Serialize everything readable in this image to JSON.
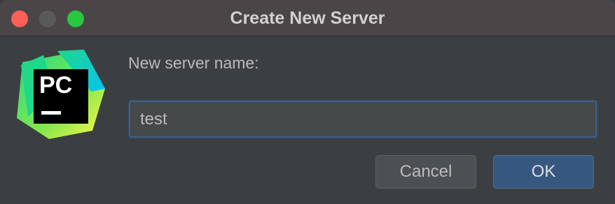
{
  "window": {
    "title": "Create New Server"
  },
  "app": {
    "logo_text": "PC"
  },
  "form": {
    "label": "New server name:",
    "server_name_value": "test"
  },
  "buttons": {
    "cancel_label": "Cancel",
    "ok_label": "OK"
  },
  "colors": {
    "close": "#fe5f57",
    "minimize": "#5a5a5a",
    "maximize": "#28c840",
    "accent": "#365880",
    "focus_border": "#3d6185"
  },
  "icons": {
    "logo": "pycharm-logo-icon"
  }
}
